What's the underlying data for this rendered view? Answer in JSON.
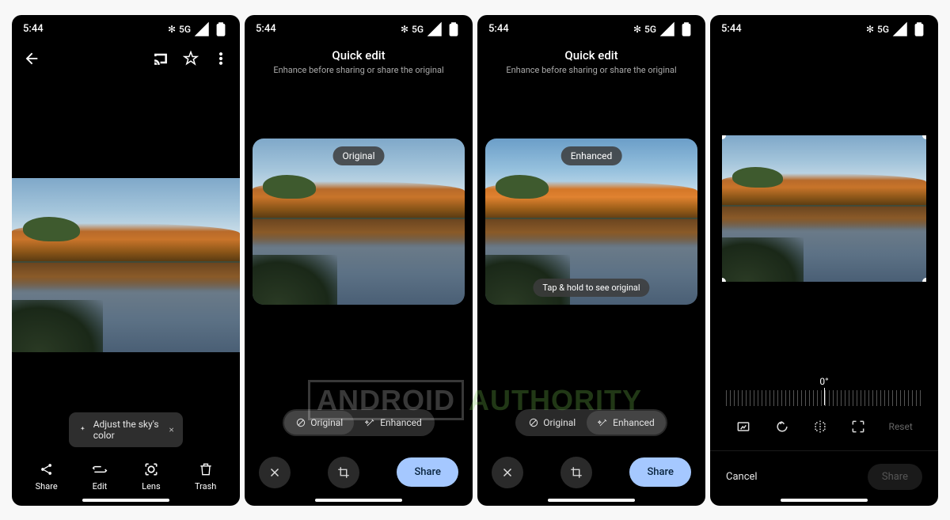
{
  "status": {
    "time": "5:44",
    "net": "5G",
    "icons": "✻"
  },
  "screen1": {
    "suggestion": "Adjust the sky's color",
    "actions": {
      "share": "Share",
      "edit": "Edit",
      "lens": "Lens",
      "trash": "Trash"
    }
  },
  "quickEdit": {
    "title": "Quick edit",
    "subtitle": "Enhance before sharing or share the original",
    "badgeOriginal": "Original",
    "badgeEnhanced": "Enhanced",
    "hint": "Tap & hold to see original",
    "toggle": {
      "original": "Original",
      "enhanced": "Enhanced"
    },
    "share": "Share"
  },
  "crop": {
    "angle": "0°",
    "reset": "Reset",
    "cancel": "Cancel",
    "share": "Share"
  },
  "watermark": {
    "a": "ANDROID",
    "b": "AUTHORITY"
  }
}
